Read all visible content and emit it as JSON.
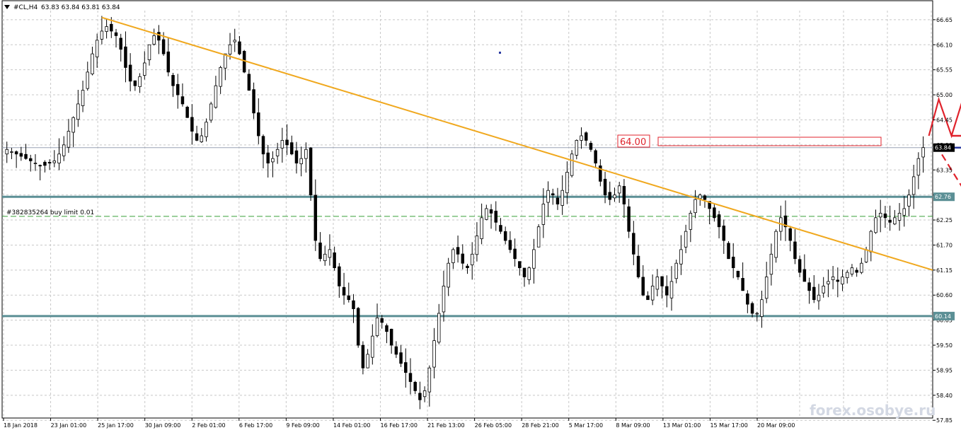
{
  "header": {
    "symbol_label": "#CL,H4",
    "ohlc_text": "63.83 63.84 63.81 63.84"
  },
  "order": {
    "label": "#382835264 buy limit 0.01",
    "price": 62.33
  },
  "annotations": {
    "target_label": "64.00",
    "watermark": "forex.osobye.ru"
  },
  "colors": {
    "background": "#ffffff",
    "grid": "#c8c8c8",
    "candle": "#000000",
    "trendline": "#f0a81e",
    "level_line": "#5b8f95",
    "arrow": "#e0232c",
    "current_price_line": "#2b3aa0",
    "last_price_box": "#000000"
  },
  "chart_data": {
    "type": "candlestick",
    "y_axis": {
      "min": 57.9,
      "max": 66.85,
      "ticks": [
        "66.65",
        "66.10",
        "65.55",
        "65.00",
        "64.45",
        "63.90",
        "63.35",
        "62.80",
        "62.25",
        "61.70",
        "61.15",
        "60.60",
        "60.05",
        "59.50",
        "58.95",
        "58.40",
        "57.85"
      ]
    },
    "x_axis": {
      "labels": [
        "18 Jan 2018",
        "23 Jan 01:00",
        "25 Jan 17:00",
        "30 Jan 09:00",
        "2 Feb 01:00",
        "6 Feb 17:00",
        "9 Feb 09:00",
        "14 Feb 01:00",
        "16 Feb 17:00",
        "21 Feb 13:00",
        "26 Feb 05:00",
        "28 Feb 21:00",
        "5 Mar 17:00",
        "8 Mar 09:00",
        "13 Mar 01:00",
        "15 Mar 17:00",
        "20 Mar 09:00"
      ]
    },
    "price_labels": {
      "current": "63.84",
      "resistance": "62.76",
      "support": "60.14"
    },
    "levels": [
      62.76,
      60.14
    ],
    "current_price": 63.84,
    "grid": true,
    "trendline": {
      "from": {
        "bar": 20,
        "price": 66.7
      },
      "to": {
        "bar": 313,
        "price": 61.15
      }
    },
    "closes": [
      63.8,
      63.75,
      63.7,
      63.65,
      63.6,
      63.55,
      63.5,
      63.45,
      63.45,
      63.5,
      63.55,
      63.7,
      63.9,
      64.2,
      64.5,
      64.8,
      65.1,
      65.5,
      65.9,
      66.2,
      66.4,
      66.5,
      66.4,
      66.3,
      66.0,
      65.6,
      65.3,
      65.2,
      65.4,
      65.7,
      66.1,
      66.3,
      66.2,
      65.9,
      65.5,
      65.2,
      65.0,
      64.8,
      64.5,
      64.2,
      64.0,
      64.1,
      64.4,
      64.8,
      65.2,
      65.6,
      65.9,
      66.1,
      66.2,
      65.9,
      65.5,
      65.1,
      64.6,
      64.1,
      63.7,
      63.5,
      63.6,
      63.8,
      64.0,
      63.9,
      63.7,
      63.5,
      63.6,
      63.8,
      62.8,
      61.8,
      61.4,
      61.5,
      61.6,
      61.2,
      60.8,
      60.6,
      60.5,
      60.3,
      59.5,
      59.0,
      59.3,
      59.7,
      60.1,
      60.0,
      59.8,
      59.5,
      59.3,
      59.1,
      58.9,
      58.7,
      58.5,
      58.3,
      58.5,
      59.0,
      59.6,
      60.2,
      60.8,
      61.3,
      61.6,
      61.5,
      61.3,
      61.2,
      61.5,
      61.9,
      62.3,
      62.5,
      62.4,
      62.2,
      62.0,
      61.8,
      61.6,
      61.4,
      61.2,
      61.0,
      61.2,
      61.6,
      62.1,
      62.6,
      62.9,
      62.8,
      62.6,
      62.9,
      63.3,
      63.7,
      64.0,
      64.1,
      64.0,
      63.8,
      63.5,
      63.1,
      62.8,
      62.7,
      62.8,
      63.0,
      62.6,
      62.0,
      61.5,
      61.0,
      60.6,
      60.5,
      60.8,
      61.0,
      60.8,
      60.6,
      60.9,
      61.3,
      61.6,
      62.0,
      62.4,
      62.7,
      62.8,
      62.7,
      62.5,
      62.3,
      62.1,
      61.8,
      61.4,
      61.2,
      61.0,
      60.7,
      60.4,
      60.2,
      60.2,
      60.5,
      61.0,
      61.5,
      62.0,
      62.3,
      62.1,
      61.8,
      61.4,
      61.1,
      60.9,
      60.7,
      60.5,
      60.6,
      60.8,
      60.9,
      61.0,
      60.9,
      61.0,
      61.1,
      61.2,
      61.1,
      61.3,
      61.6,
      62.0,
      62.3,
      62.4,
      62.3,
      62.2,
      62.3,
      62.4,
      62.5,
      62.8,
      63.2,
      63.6,
      63.84
    ]
  }
}
